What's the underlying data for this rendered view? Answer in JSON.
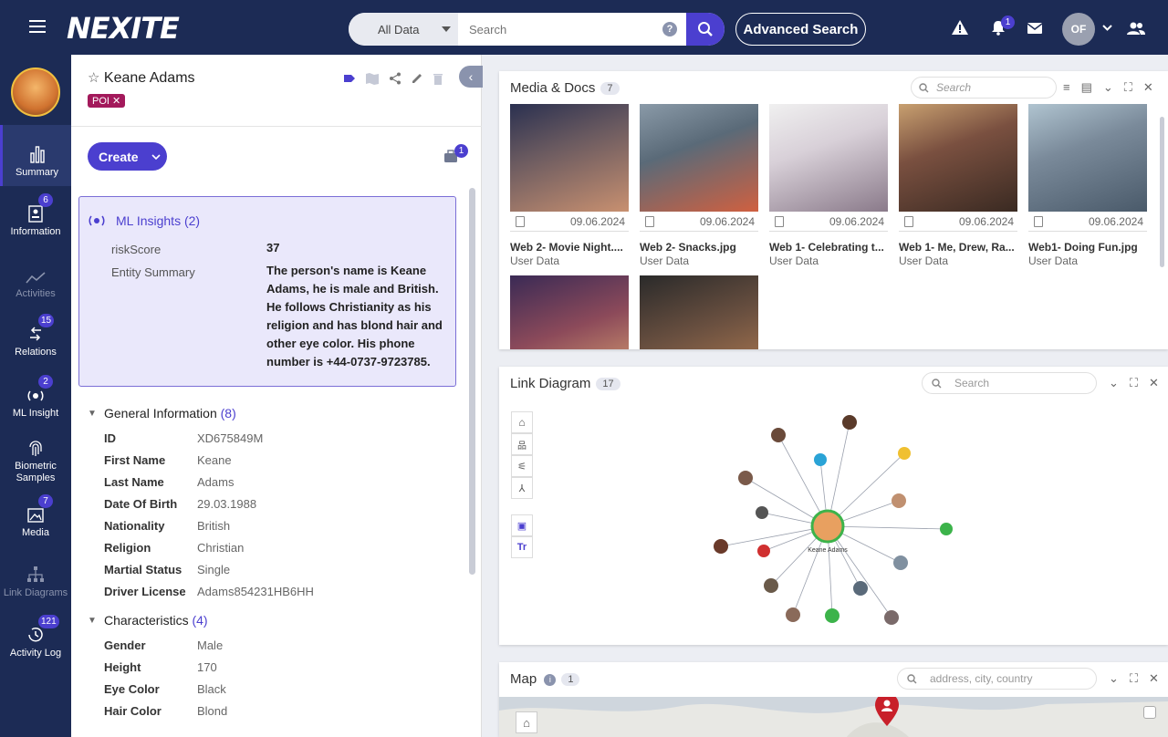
{
  "app": {
    "logo": "NEXITE"
  },
  "topbar": {
    "filter_label": "All Data",
    "search_placeholder": "Search",
    "help_glyph": "?",
    "advanced_search_label": "Advanced Search",
    "notifications_count": "1",
    "user_initials": "OF"
  },
  "nav": {
    "items": [
      {
        "label": "Summary",
        "badge": ""
      },
      {
        "label": "Information",
        "badge": "6"
      },
      {
        "label": "Activities",
        "badge": ""
      },
      {
        "label": "Relations",
        "badge": "15"
      },
      {
        "label": "ML Insight",
        "badge": "2"
      },
      {
        "label": "Biometric Samples",
        "badge": ""
      },
      {
        "label": "Media",
        "badge": "7"
      },
      {
        "label": "Link Diagrams",
        "badge": ""
      },
      {
        "label": "Activity Log",
        "badge": "121"
      }
    ]
  },
  "entity": {
    "name": "Keane Adams",
    "tag": "POI",
    "create_label": "Create",
    "briefcase_count": "1"
  },
  "ml_insights": {
    "title": "ML Insights",
    "count": "(2)",
    "risk_label": "riskScore",
    "risk_value": "37",
    "summary_label": "Entity Summary",
    "summary_value": "The person's name is Keane Adams, he is male and British. He follows Christianity as his religion and has blond hair and other eye color. His phone number is +44-0737-9723785."
  },
  "general_info": {
    "title": "General Information",
    "count": "(8)",
    "fields": [
      {
        "label": "ID",
        "value": "XD675849M"
      },
      {
        "label": "First Name",
        "value": "Keane"
      },
      {
        "label": "Last Name",
        "value": "Adams"
      },
      {
        "label": "Date Of Birth",
        "value": "29.03.1988"
      },
      {
        "label": "Nationality",
        "value": "British"
      },
      {
        "label": "Religion",
        "value": "Christian"
      },
      {
        "label": "Martial Status",
        "value": "Single"
      },
      {
        "label": "Driver License",
        "value": "Adams854231HB6HH"
      }
    ]
  },
  "characteristics": {
    "title": "Characteristics",
    "count": "(4)",
    "fields": [
      {
        "label": "Gender",
        "value": "Male"
      },
      {
        "label": "Height",
        "value": "170"
      },
      {
        "label": "Eye Color",
        "value": "Black"
      },
      {
        "label": "Hair Color",
        "value": "Blond"
      }
    ]
  },
  "media": {
    "title": "Media & Docs",
    "count": "7",
    "search_placeholder": "Search",
    "items": [
      {
        "date": "09.06.2024",
        "name": "Web 2- Movie Night....",
        "source": "User Data"
      },
      {
        "date": "09.06.2024",
        "name": "Web 2- Snacks.jpg",
        "source": "User Data"
      },
      {
        "date": "09.06.2024",
        "name": "Web 1- Celebrating t...",
        "source": "User Data"
      },
      {
        "date": "09.06.2024",
        "name": "Web 1- Me, Drew, Ra...",
        "source": "User Data"
      },
      {
        "date": "09.06.2024",
        "name": "Web1- Doing Fun.jpg",
        "source": "User Data"
      }
    ]
  },
  "link_diagram": {
    "title": "Link Diagram",
    "count": "17",
    "search_placeholder": "Search",
    "center_label": "Keane Adams"
  },
  "map": {
    "title": "Map",
    "count": "1",
    "search_placeholder": "address, city, country"
  }
}
